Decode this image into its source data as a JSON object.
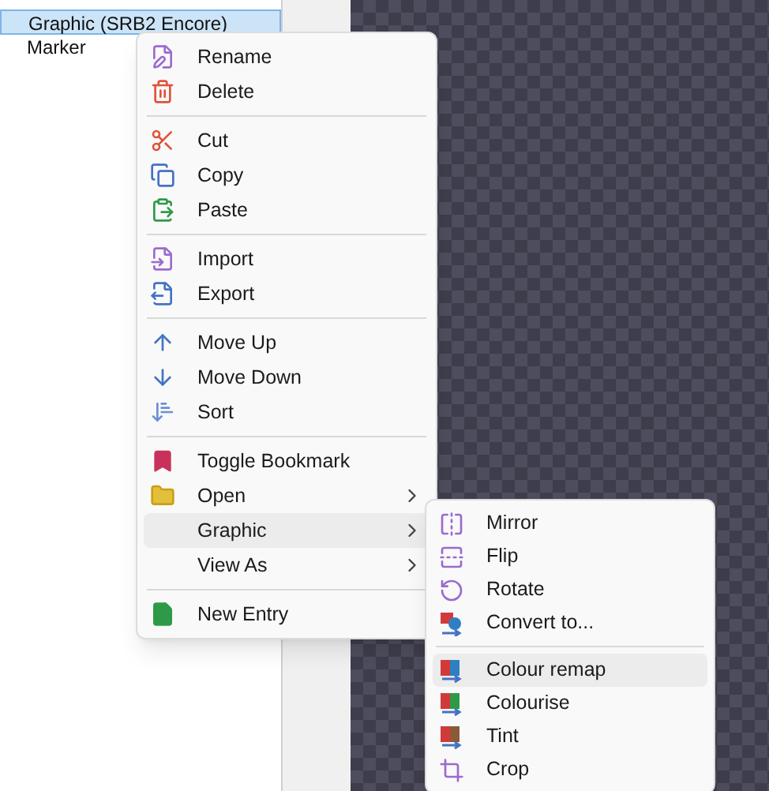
{
  "entry_list": [
    {
      "label": "Graphic (SRB2 Encore)",
      "selected": true
    },
    {
      "label": "Marker",
      "selected": false
    }
  ],
  "context_menu": {
    "groups": [
      [
        {
          "label": "Rename",
          "selected": false,
          "submenu": false
        },
        {
          "label": "Delete",
          "selected": false,
          "submenu": false
        }
      ],
      [
        {
          "label": "Cut",
          "selected": false,
          "submenu": false
        },
        {
          "label": "Copy",
          "selected": false,
          "submenu": false
        },
        {
          "label": "Paste",
          "selected": false,
          "submenu": false
        }
      ],
      [
        {
          "label": "Import",
          "selected": false,
          "submenu": false
        },
        {
          "label": "Export",
          "selected": false,
          "submenu": false
        }
      ],
      [
        {
          "label": "Move Up",
          "selected": false,
          "submenu": false
        },
        {
          "label": "Move Down",
          "selected": false,
          "submenu": false
        },
        {
          "label": "Sort",
          "selected": false,
          "submenu": false
        }
      ],
      [
        {
          "label": "Toggle Bookmark",
          "selected": false,
          "submenu": false
        },
        {
          "label": "Open",
          "selected": false,
          "submenu": true
        },
        {
          "label": "Graphic",
          "selected": true,
          "submenu": true
        },
        {
          "label": "View As",
          "selected": false,
          "submenu": true
        }
      ],
      [
        {
          "label": "New Entry",
          "selected": false,
          "submenu": false
        }
      ]
    ]
  },
  "submenu": {
    "groups": [
      [
        {
          "label": "Mirror",
          "selected": false
        },
        {
          "label": "Flip",
          "selected": false
        },
        {
          "label": "Rotate",
          "selected": false
        },
        {
          "label": "Convert to...",
          "selected": false
        }
      ],
      [
        {
          "label": "Colour remap",
          "selected": true
        },
        {
          "label": "Colourise",
          "selected": false
        },
        {
          "label": "Tint",
          "selected": false
        },
        {
          "label": "Crop",
          "selected": false
        }
      ]
    ]
  }
}
